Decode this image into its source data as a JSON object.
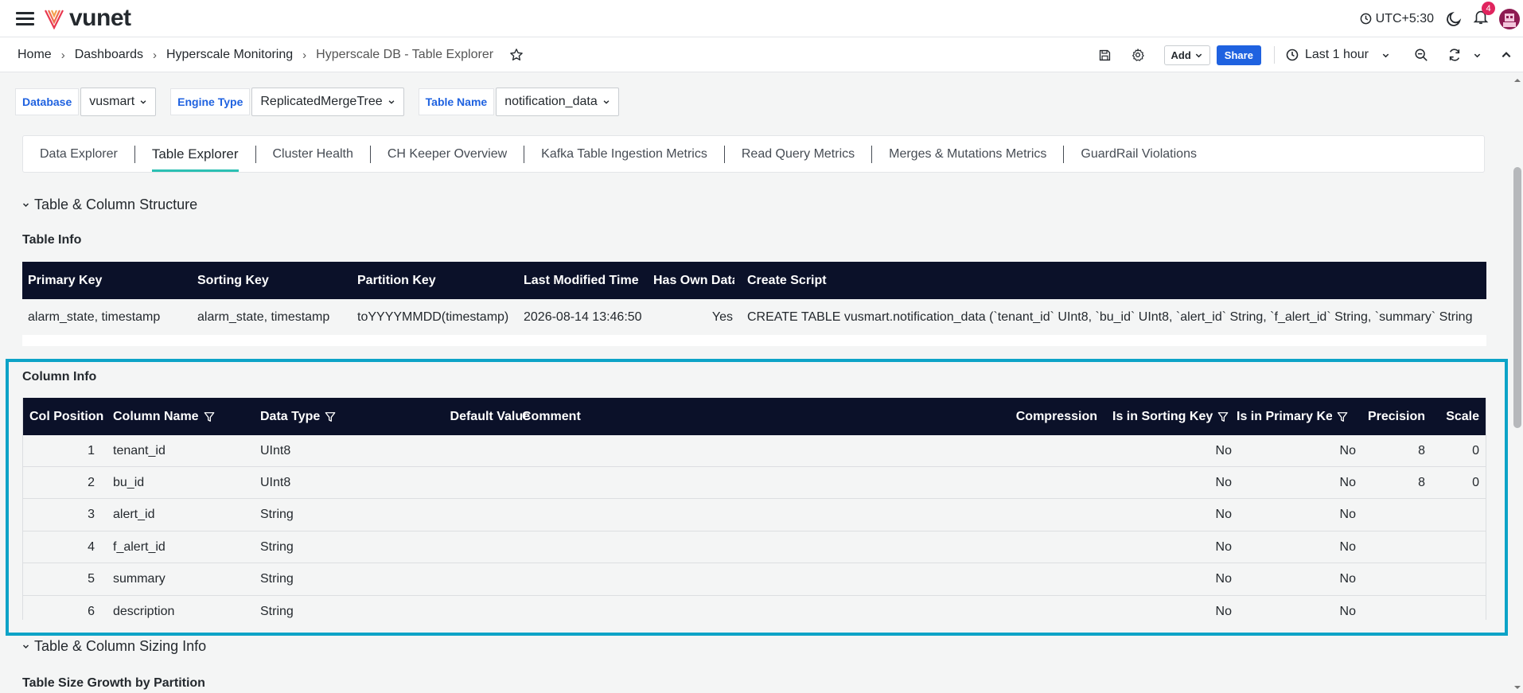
{
  "app": {
    "brand": "vunet",
    "timezone": "UTC+5:30",
    "notification_count": "4"
  },
  "breadcrumb": [
    "Home",
    "Dashboards",
    "Hyperscale Monitoring",
    "Hyperscale DB - Table Explorer"
  ],
  "toolbar": {
    "add_label": "Add",
    "share_label": "Share",
    "time_range": "Last 1 hour"
  },
  "variables": [
    {
      "label": "Database",
      "value": "vusmart"
    },
    {
      "label": "Engine Type",
      "value": "ReplicatedMergeTree"
    },
    {
      "label": "Table Name",
      "value": "notification_data"
    }
  ],
  "tabs": [
    {
      "label": "Data Explorer"
    },
    {
      "label": "Table Explorer",
      "active": true
    },
    {
      "label": "Cluster Health"
    },
    {
      "label": "CH Keeper Overview"
    },
    {
      "label": "Kafka Table Ingestion Metrics"
    },
    {
      "label": "Read Query Metrics"
    },
    {
      "label": "Merges & Mutations Metrics"
    },
    {
      "label": "GuardRail Violations"
    }
  ],
  "sections": {
    "structure_title": "Table & Column Structure",
    "sizing_title": "Table & Column Sizing Info"
  },
  "table_info": {
    "title": "Table Info",
    "columns": [
      "Primary Key",
      "Sorting Key",
      "Partition Key",
      "Last Modified Time",
      "Has Own Data",
      "Create Script"
    ],
    "row": [
      "alarm_state, timestamp",
      "alarm_state, timestamp",
      "toYYYYMMDD(timestamp)",
      "2026-08-14 13:46:50",
      "Yes",
      "CREATE TABLE vusmart.notification_data (`tenant_id` UInt8, `bu_id` UInt8, `alert_id` String, `f_alert_id` String, `summary` String"
    ]
  },
  "column_info": {
    "title": "Column Info",
    "columns": [
      "Col Position",
      "Column Name",
      "Data Type",
      "Default Value",
      "Comment",
      "Compression",
      "Is in Sorting Key",
      "Is in Primary Key",
      "Precision",
      "Scale"
    ],
    "rows": [
      [
        "1",
        "tenant_id",
        "UInt8",
        "",
        "",
        "",
        "No",
        "No",
        "8",
        "0"
      ],
      [
        "2",
        "bu_id",
        "UInt8",
        "",
        "",
        "",
        "No",
        "No",
        "8",
        "0"
      ],
      [
        "3",
        "alert_id",
        "String",
        "",
        "",
        "",
        "No",
        "No",
        "",
        ""
      ],
      [
        "4",
        "f_alert_id",
        "String",
        "",
        "",
        "",
        "No",
        "No",
        "",
        ""
      ],
      [
        "5",
        "summary",
        "String",
        "",
        "",
        "",
        "No",
        "No",
        "",
        ""
      ],
      [
        "6",
        "description",
        "String",
        "",
        "",
        "",
        "No",
        "No",
        "",
        ""
      ]
    ]
  },
  "sizing": {
    "panel_title": "Table Size Growth by Partition"
  },
  "colors": {
    "header_bg": "#0b1129",
    "accent": "#1f62e0",
    "tab_underline": "#2bc0b3",
    "highlight": "#0da3c7",
    "brand": "#e8384f"
  }
}
